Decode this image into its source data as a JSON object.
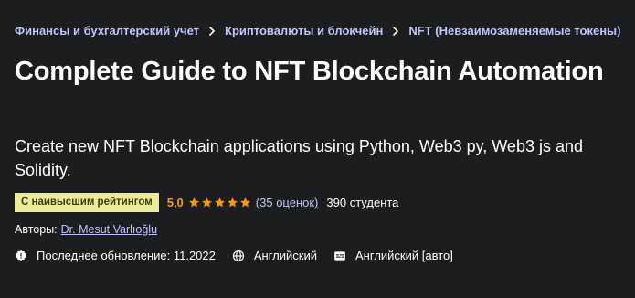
{
  "breadcrumb": {
    "items": [
      {
        "label": "Финансы и бухгалтерский учет"
      },
      {
        "label": "Криптовалюты и блокчейн"
      },
      {
        "label": "NFT (Невзаимозаменяемые токены)"
      }
    ]
  },
  "course": {
    "title": "Complete Guide to NFT Blockchain Automation",
    "subtitle": "Create new NFT Blockchain applications using Python, Web3 py, Web3 js and Solidity."
  },
  "rating": {
    "badge": "С наивысшим рейтингом",
    "value": "5,0",
    "stars": 5,
    "reviews": "(35 оценок)",
    "students": "390 студента"
  },
  "authors": {
    "label": "Авторы:",
    "name": "Dr. Mesut Varlıoğlu"
  },
  "meta": {
    "updated": "Последнее обновление: 11.2022",
    "language": "Английский",
    "captions": "Английский [авто]"
  },
  "colors": {
    "background": "#1c1d1f",
    "link": "#c0c4fc",
    "badge_bg": "#eceb98",
    "badge_text": "#3d3c0a",
    "star": "#f69c08"
  },
  "icons": {
    "breadcrumb_separator": "chevron-right-icon",
    "update": "alert-badge-icon",
    "language": "globe-icon",
    "captions": "closed-captions-icon"
  }
}
